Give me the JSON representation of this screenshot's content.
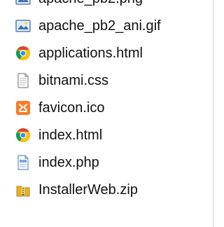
{
  "files": [
    {
      "name": "apache_pb2.png",
      "icon": "image-file-icon"
    },
    {
      "name": "apache_pb2_ani.gif",
      "icon": "image-file-icon"
    },
    {
      "name": "applications.html",
      "icon": "chrome-html-icon"
    },
    {
      "name": "bitnami.css",
      "icon": "text-document-icon"
    },
    {
      "name": "favicon.ico",
      "icon": "xampp-icon"
    },
    {
      "name": "index.html",
      "icon": "chrome-html-icon"
    },
    {
      "name": "index.php",
      "icon": "php-document-icon"
    },
    {
      "name": "InstallerWeb.zip",
      "icon": "zip-archive-icon"
    }
  ],
  "colors": {
    "text": "#111111",
    "chrome_red": "#db4437",
    "chrome_yellow": "#f4c20d",
    "chrome_green": "#0f9d58",
    "chrome_blue": "#4285f4",
    "xampp_orange": "#fb7a24",
    "zip_gold": "#e4b12f"
  }
}
